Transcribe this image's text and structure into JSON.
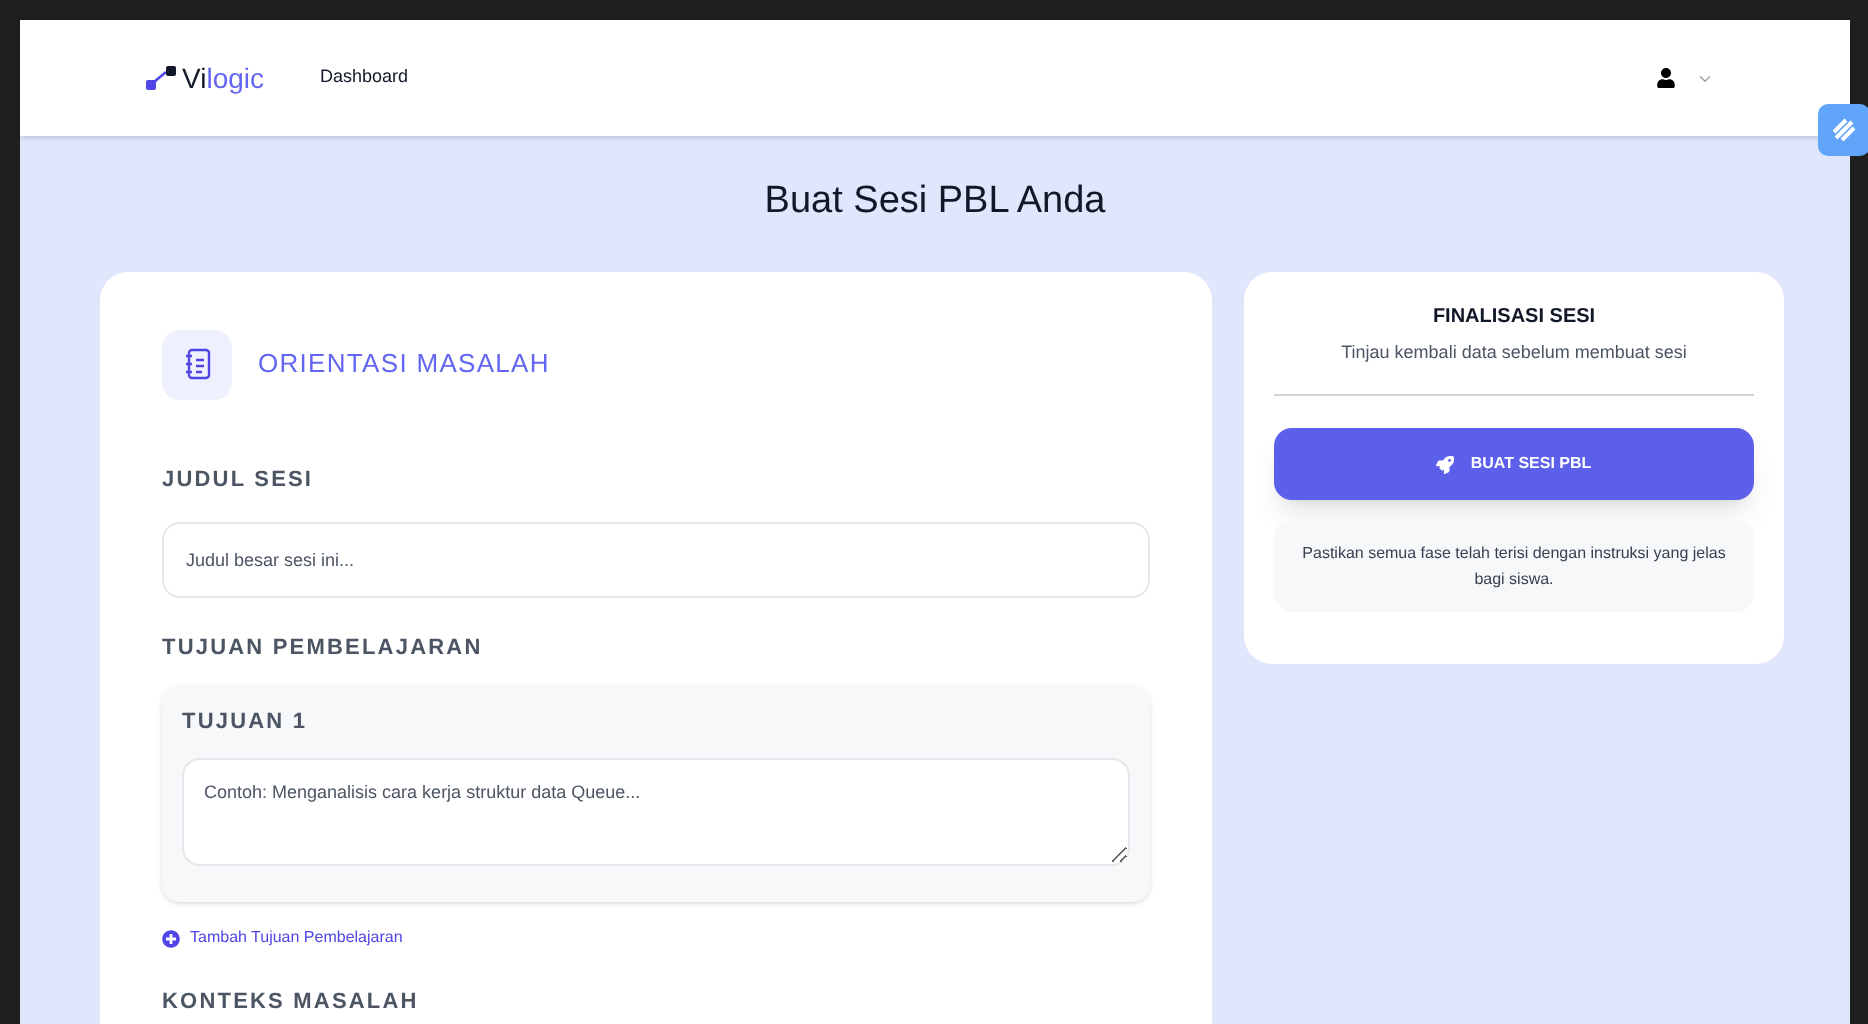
{
  "header": {
    "brand": {
      "part_1": "Vi",
      "part_2": "logic"
    },
    "nav": [
      {
        "label": "Dashboard"
      }
    ]
  },
  "page_title": "Buat Sesi PBL Anda",
  "form": {
    "section_title": "ORIENTASI MASALAH",
    "title_field": {
      "label": "JUDUL SESI",
      "placeholder": "Judul besar sesi ini..."
    },
    "objectives": {
      "label": "TUJUAN PEMBELAJARAN",
      "items": [
        {
          "label": "TUJUAN 1",
          "placeholder": "Contoh: Menganalisis cara kerja struktur data Queue..."
        }
      ],
      "add_link": "Tambah Tujuan Pembelajaran"
    },
    "context": {
      "label": "KONTEKS MASALAH"
    }
  },
  "finalize": {
    "title": "FINALISASI SESI",
    "subtitle": "Tinjau kembali data sebelum membuat sesi",
    "button": "BUAT SESI PBL",
    "note": "Pastikan semua fase telah terisi dengan instruksi yang jelas bagi siswa."
  }
}
